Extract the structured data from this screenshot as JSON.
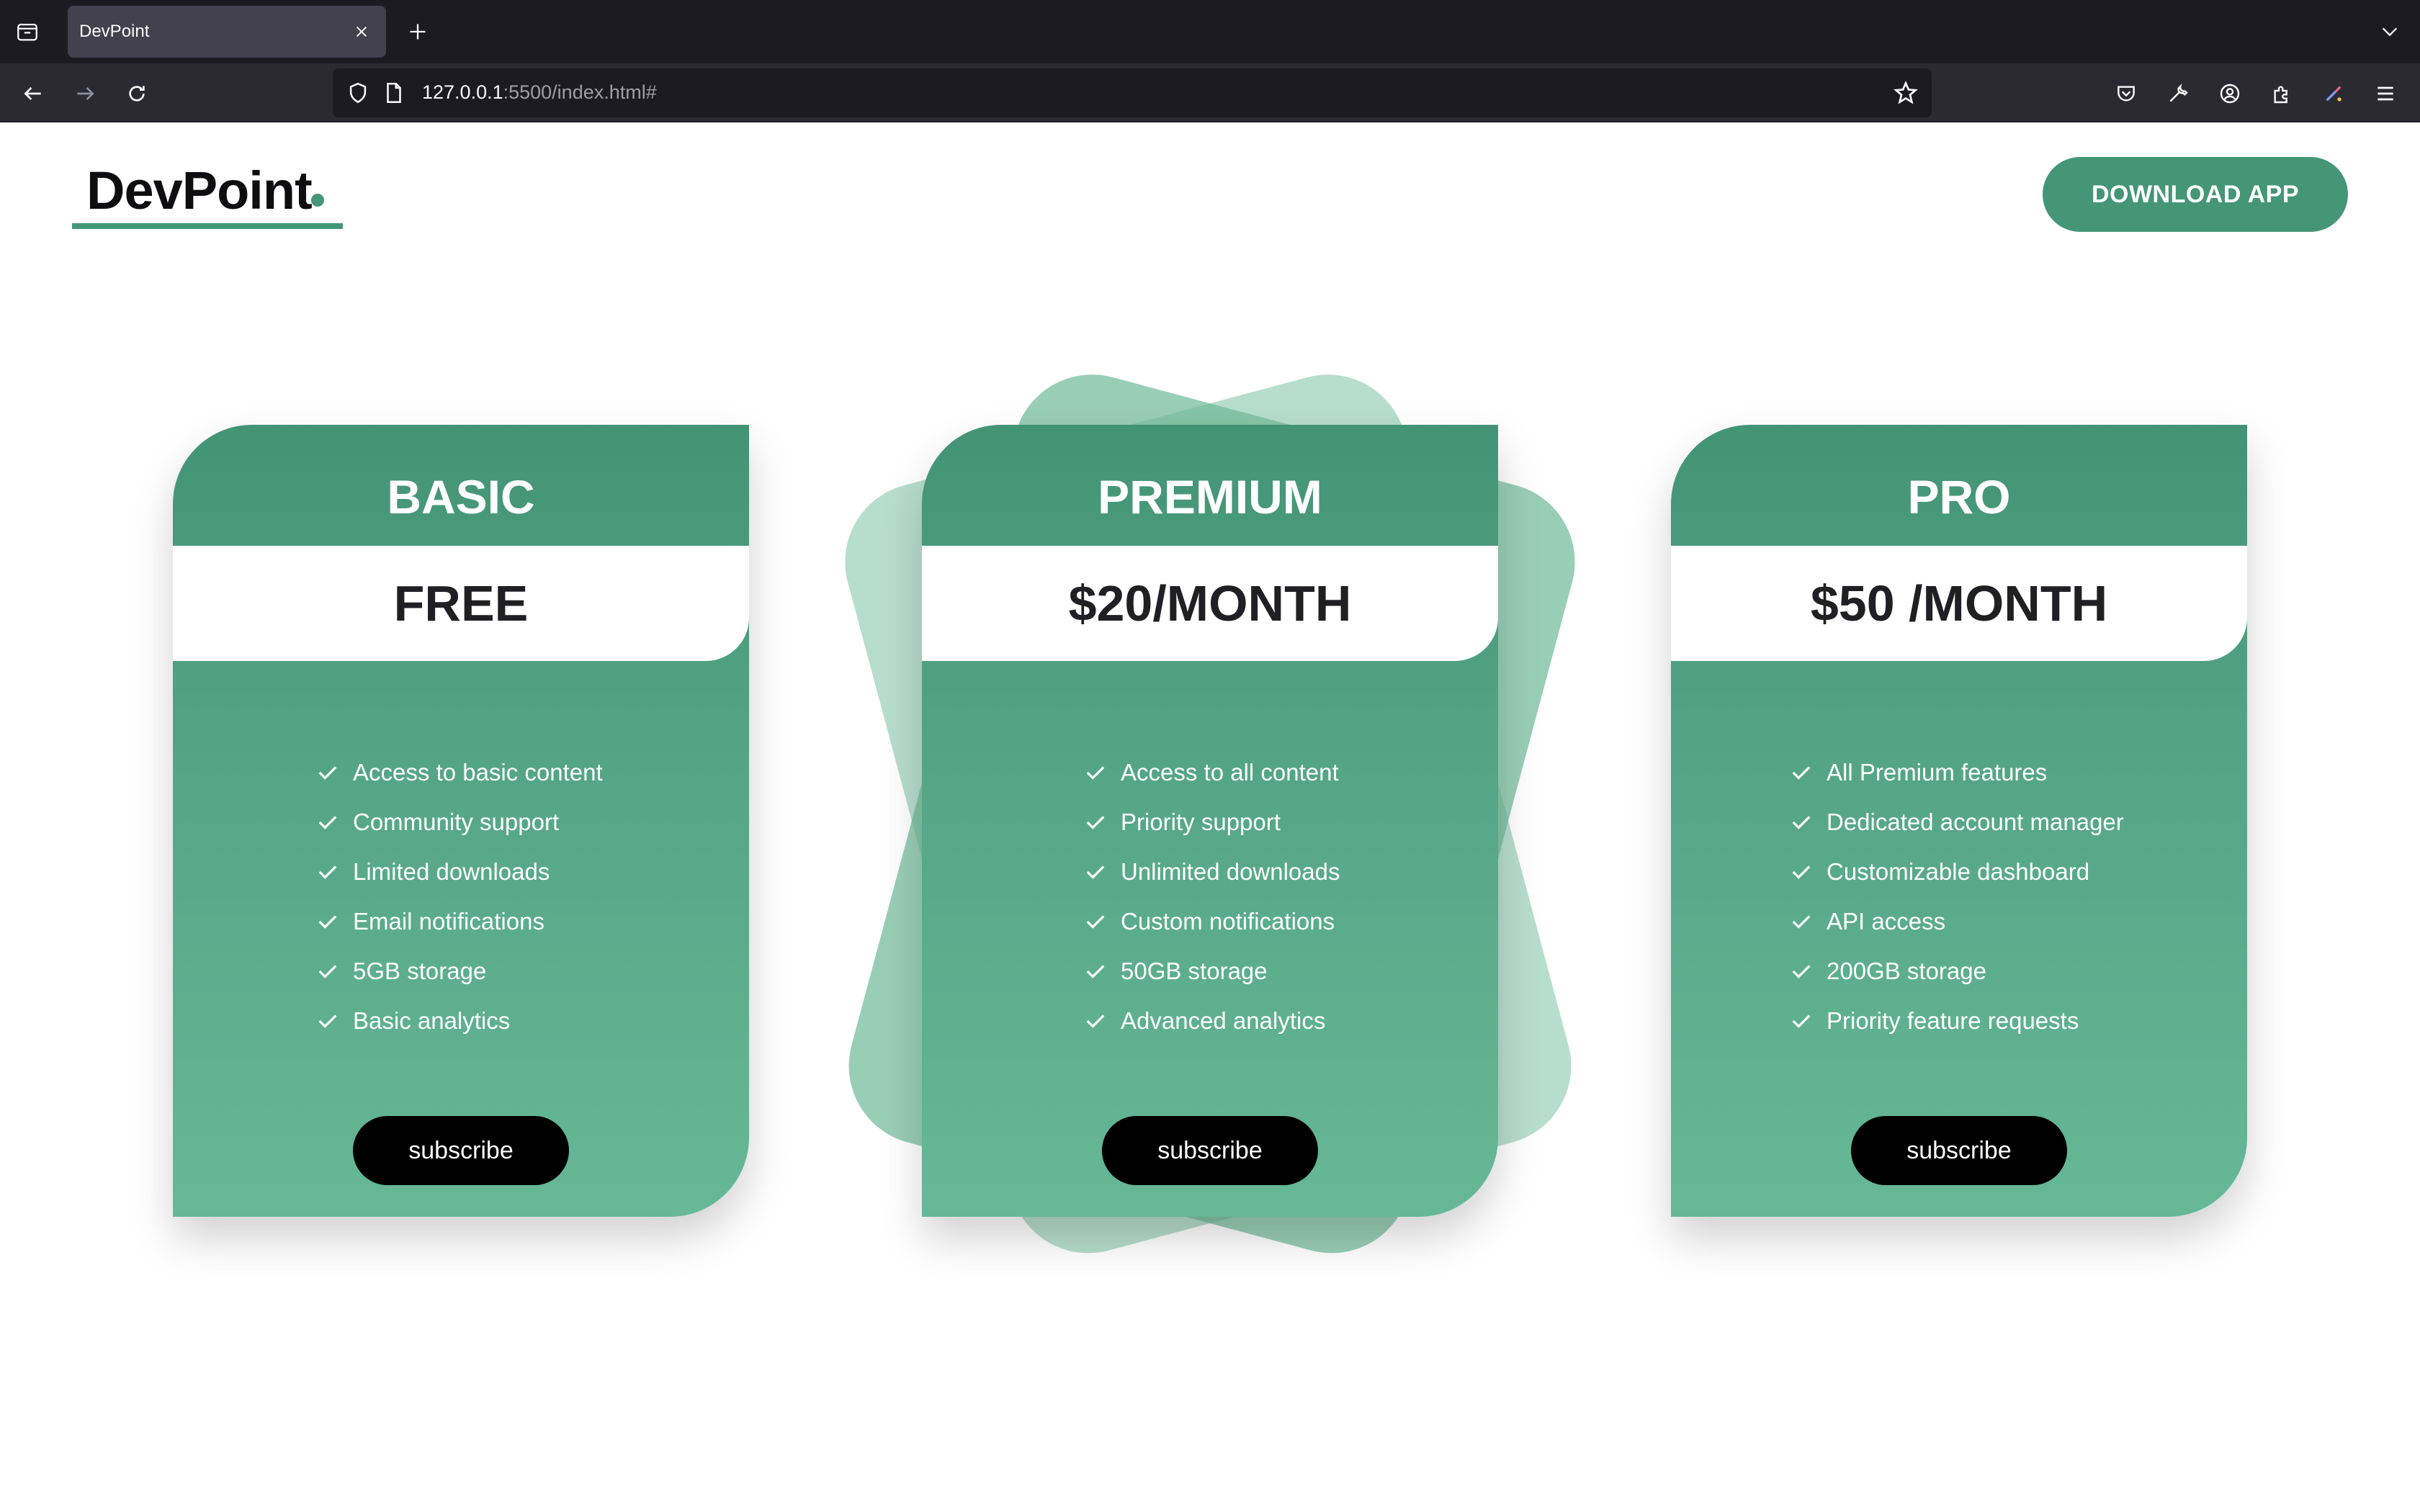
{
  "browser": {
    "tab_title": "DevPoint",
    "url_host": "127.0.0.1",
    "url_rest": ":5500/index.html#"
  },
  "header": {
    "logo": "DevPoint",
    "download_label": "DOWNLOAD APP"
  },
  "colors": {
    "brand_green": "#449677",
    "card_top": "#439375",
    "card_bottom": "#66b896",
    "subscribe_bg": "#000000"
  },
  "plans": [
    {
      "name": "BASIC",
      "price": "FREE",
      "features": [
        "Access to basic content",
        "Community support",
        "Limited downloads",
        "Email notifications",
        "5GB storage",
        "Basic analytics"
      ],
      "button": "subscribe"
    },
    {
      "name": "PREMIUM",
      "price": "$20/MONTH",
      "features": [
        "Access to all content",
        "Priority support",
        "Unlimited downloads",
        "Custom notifications",
        "50GB storage",
        "Advanced analytics"
      ],
      "button": "subscribe"
    },
    {
      "name": "PRO",
      "price": "$50 /MONTH",
      "features": [
        "All Premium features",
        "Dedicated account manager",
        "Customizable dashboard",
        "API access",
        "200GB storage",
        "Priority feature requests"
      ],
      "button": "subscribe"
    }
  ]
}
